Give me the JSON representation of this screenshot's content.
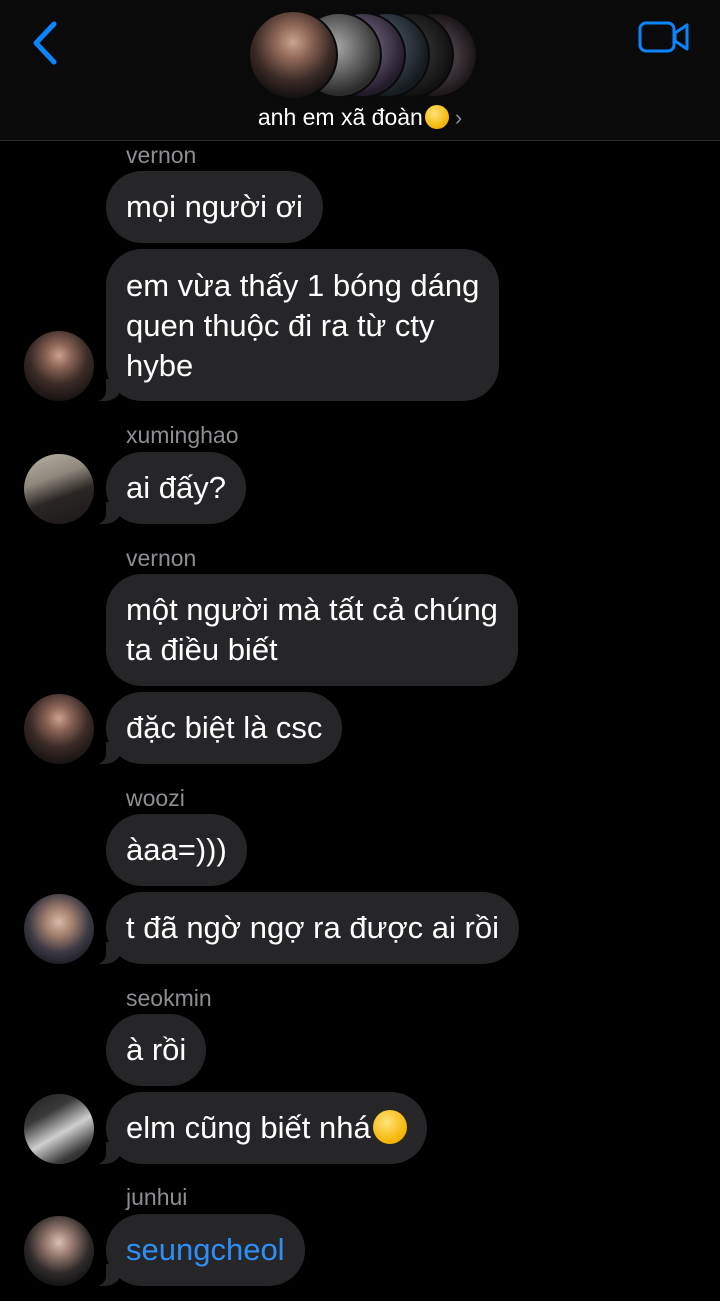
{
  "header": {
    "title": "anh em xã đoàn",
    "title_emoji": "smiling-face-with-tear-emoji",
    "back_icon": "chevron-left-icon",
    "video_icon": "video-camera-icon",
    "accent_color": "#0a84ff"
  },
  "messages": [
    {
      "sender": "vernon",
      "text": "mọi người ơi"
    },
    {
      "text_lines": [
        "em vừa thấy 1 bóng dáng",
        "quen thuộc đi ra từ cty",
        "hybe"
      ]
    },
    {
      "sender": "xuminghao",
      "text": "ai đấy?"
    },
    {
      "sender": "vernon",
      "text_lines": [
        "một người mà tất cả chúng",
        "ta điều biết"
      ]
    },
    {
      "text": "đặc biệt là csc"
    },
    {
      "sender": "woozi",
      "text": "àaa=)))"
    },
    {
      "text": "t đã ngờ ngợ ra được ai rồi"
    },
    {
      "sender": "seokmin",
      "text": "à rồi"
    },
    {
      "text": "elm cũng biết nhá",
      "emoji": "smiling-face-emoji"
    },
    {
      "sender": "junhui",
      "text": "seungcheol",
      "style": "mention"
    }
  ]
}
